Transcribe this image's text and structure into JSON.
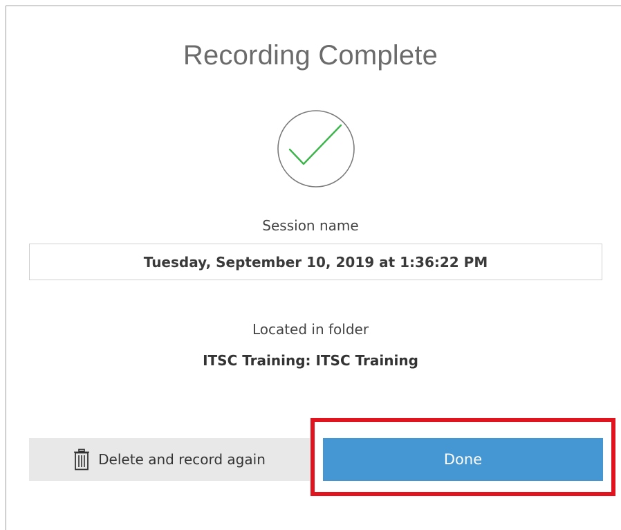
{
  "dialog": {
    "title": "Recording Complete",
    "status_icon": "check-circle-icon",
    "session": {
      "label": "Session name",
      "value": "Tuesday, September 10, 2019 at 1:36:22 PM"
    },
    "folder": {
      "label": "Located in folder",
      "value": "ITSC Training: ITSC Training"
    },
    "buttons": {
      "delete_label": "Delete and record again",
      "delete_icon": "trash-icon",
      "done_label": "Done"
    }
  },
  "colors": {
    "check": "#3bb54a",
    "circle": "#7a7a7a",
    "done_button": "#4597d3",
    "delete_button": "#e8e8e8",
    "highlight": "#e0141e"
  }
}
